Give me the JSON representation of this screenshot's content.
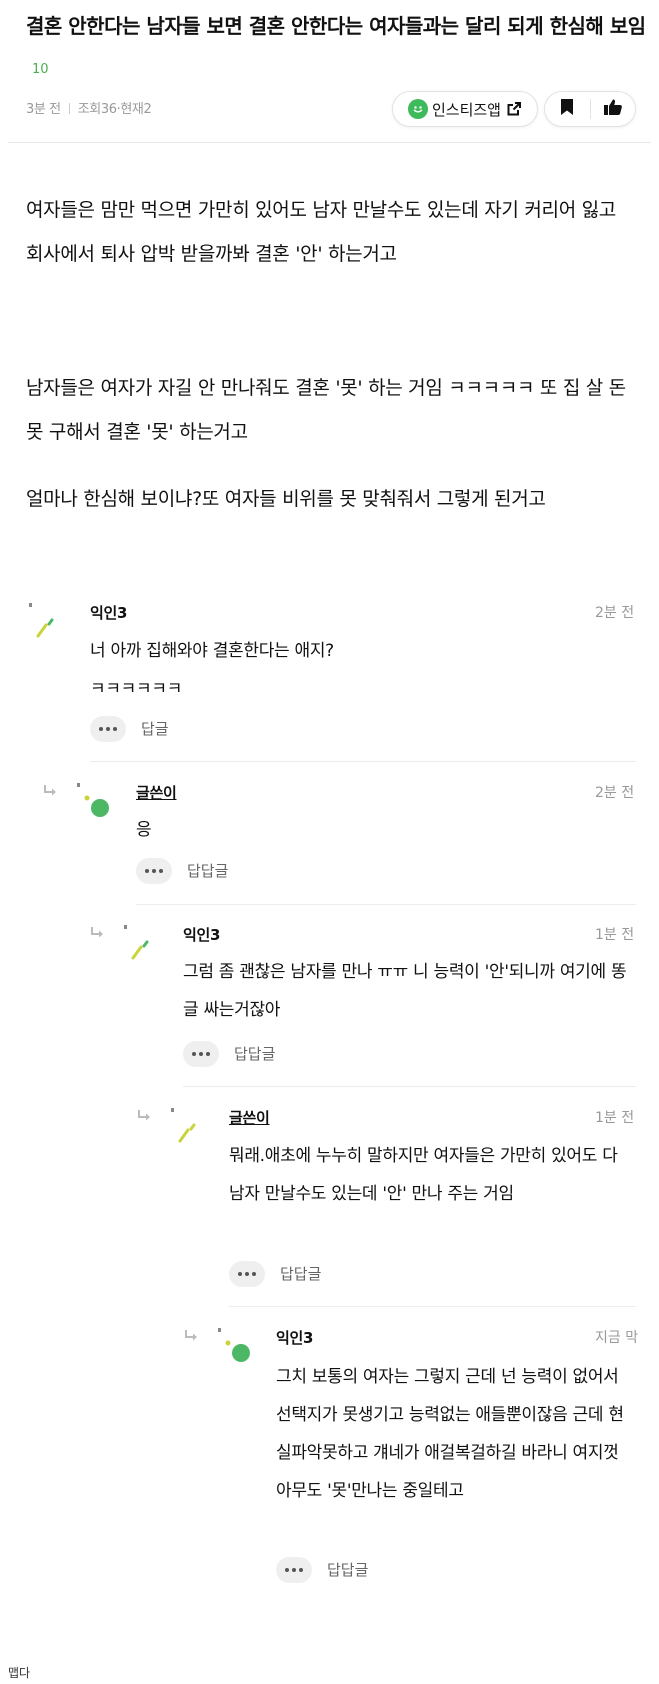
{
  "post": {
    "title": "결혼 안한다는 남자들 보면 결혼 안한다는 여자들과는 달리 되게 한심해 보임",
    "comment_count": "10",
    "time": "3분 전",
    "views": "조회36·현재2",
    "insti_label": "인스티즈앱",
    "paragraphs": [
      "여자들은 맘만 먹으면 가만히 있어도 남자 만날수도 있는데 자기 커리어 잃고 회사에서 퇴사 압박 받을까봐 결혼 '안' 하는거고",
      "남자들은 여자가 자길 안 만나줘도 결혼 '못' 하는 거임 ㅋㅋㅋㅋㅋ 또 집 살 돈 못 구해서 결혼 '못' 하는거고",
      "얼마나 한심해 보이냐?또 여자들 비위를 못 맞춰줘서 그렇게 된거고"
    ]
  },
  "comments": [
    {
      "author": "익인3",
      "time": "2분 전",
      "text": "너 아까 집해와야 결혼한다는 애지?\nㅋㅋㅋㅋㅋㅋ",
      "reply_label": "답글"
    },
    {
      "author": "글쓴이",
      "time": "2분 전",
      "text": "응",
      "reply_label": "답답글"
    },
    {
      "author": "익인3",
      "time": "1분 전",
      "text": "그럼 좀 괜찮은 남자를 만나 ㅠㅠ 니 능력이 '안'되니까 여기에 똥글 싸는거잖아",
      "reply_label": "답답글"
    },
    {
      "author": "글쓴이",
      "time": "1분 전",
      "text": "뭐래.애초에 누누히 말하지만 여자들은 가만히 있어도 다 남자 만날수도 있는데 '안' 만나 주는 거임",
      "reply_label": "답답글"
    },
    {
      "author": "익인3",
      "time": "지금 막",
      "text": "그치 보통의 여자는 그렇지 근데 넌 능력이 없어서 선택지가 못생기고 능력없는 애들뿐이잖음 근데 현실파악못하고 걔네가 애걸복걸하길 바라니 여지껏 아무도 '못'만나는 중일테고",
      "reply_label": "답답글"
    }
  ],
  "footer": {
    "text": "맵다"
  },
  "colors": {
    "accent_green": "#3dbb5c",
    "avatar_green": "#4cb865",
    "avatar_yellow": "#c8d43a"
  }
}
